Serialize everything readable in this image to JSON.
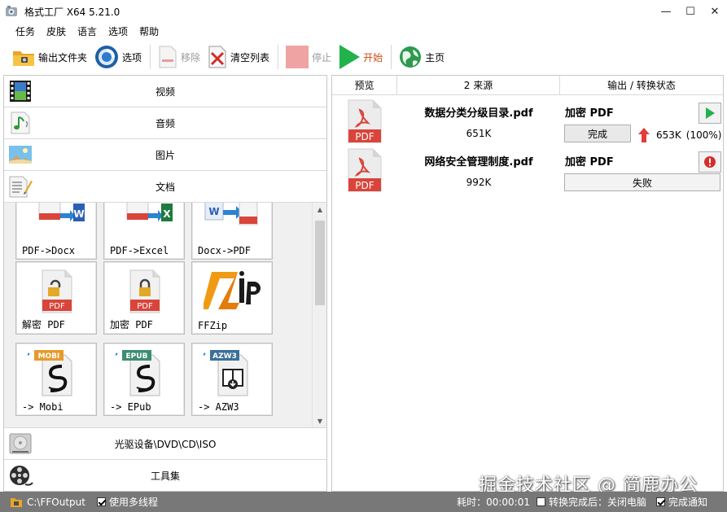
{
  "window": {
    "title": "格式工厂 X64 5.21.0"
  },
  "menu": [
    "任务",
    "皮肤",
    "语言",
    "选项",
    "帮助"
  ],
  "toolbar": {
    "output_folder": "输出文件夹",
    "options": "选项",
    "remove": "移除",
    "clear_list": "清空列表",
    "stop": "停止",
    "start": "开始",
    "home": "主页"
  },
  "categories": {
    "video": "视频",
    "audio": "音频",
    "image": "图片",
    "document": "文档",
    "optical": "光驱设备\\DVD\\CD\\ISO",
    "tools": "工具集"
  },
  "tiles": [
    "PDF->Docx",
    "PDF->Excel",
    "Docx->PDF",
    "解密 PDF",
    "加密 PDF",
    "FFZip",
    "-> Mobi",
    "-> EPub",
    "-> AZW3"
  ],
  "tile_badges": {
    "mobi": "MOBI",
    "epub": "EPUB",
    "azw3": "AZW3",
    "pdf": "PDF"
  },
  "table": {
    "col_preview": "预览",
    "col_source": "2 来源",
    "col_status": "输出 / 转换状态"
  },
  "tasks": [
    {
      "file": "数据分类分级目录.pdf",
      "size": "651K",
      "output_type": "加密 PDF",
      "status": "完成",
      "out_size": "653K",
      "percent": "(100%)"
    },
    {
      "file": "网络安全管理制度.pdf",
      "size": "992K",
      "output_type": "加密 PDF",
      "status": "失败"
    }
  ],
  "statusbar": {
    "output_path": "C:\\FFOutput",
    "multithread": "使用多线程",
    "elapsed": "耗时：00:00:01",
    "after_done": "转换完成后：关闭电脑",
    "notify": "完成通知"
  },
  "watermark": "掘金技术社区 @ 简鹿办公",
  "colors": {
    "accent_green": "#22b24c",
    "pdf_red": "#d9453a",
    "status_gray": "#787878",
    "arrow_red": "#e23b3b"
  }
}
